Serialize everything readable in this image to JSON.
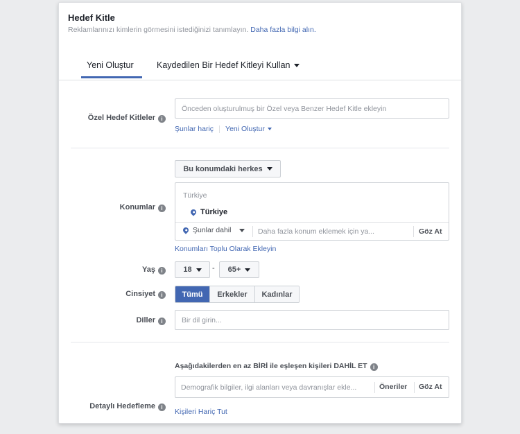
{
  "header": {
    "title": "Hedef Kitle",
    "description": "Reklamlarınızı kimlerin görmesini istediğinizi tanımlayın.",
    "learn_more": "Daha fazla bilgi alın."
  },
  "tabs": [
    {
      "label": "Yeni Oluştur"
    },
    {
      "label": "Kaydedilen Bir Hedef Kitleyi Kullan"
    }
  ],
  "custom_audiences": {
    "label": "Özel Hedef Kitleler",
    "placeholder": "Önceden oluşturulmuş bir Özel veya Benzer Hedef Kitle ekleyin",
    "exclude_link": "Şunlar hariç",
    "create_new_link": "Yeni Oluştur"
  },
  "locations": {
    "label": "Konumlar",
    "scope_dropdown": "Bu konumdaki herkes",
    "country_header": "Türkiye",
    "selected_location": "Türkiye",
    "include_dropdown": "Şunlar dahil",
    "search_placeholder": "Daha fazla konum eklemek için ya...",
    "browse": "Göz At",
    "bulk_add_link": "Konumları Toplu Olarak Ekleyin"
  },
  "age": {
    "label": "Yaş",
    "min": "18",
    "separator": "-",
    "max": "65+"
  },
  "gender": {
    "label": "Cinsiyet",
    "options": [
      "Tümü",
      "Erkekler",
      "Kadınlar"
    ],
    "selected": "Tümü"
  },
  "languages": {
    "label": "Diller",
    "placeholder": "Bir dil girin..."
  },
  "detailed_targeting": {
    "label": "Detaylı Hedefleme",
    "include_text": "Aşağıdakilerden en az BİRİ ile eşleşen kişileri DAHİL ET",
    "placeholder": "Demografik bilgiler, ilgi alanları veya davranışlar ekle...",
    "suggestions": "Öneriler",
    "browse": "Göz At",
    "exclude_link": "Kişileri Hariç Tut"
  },
  "colors": {
    "accent": "#4267b2",
    "label_gray": "#4b4f56",
    "placeholder_gray": "#90949c"
  }
}
